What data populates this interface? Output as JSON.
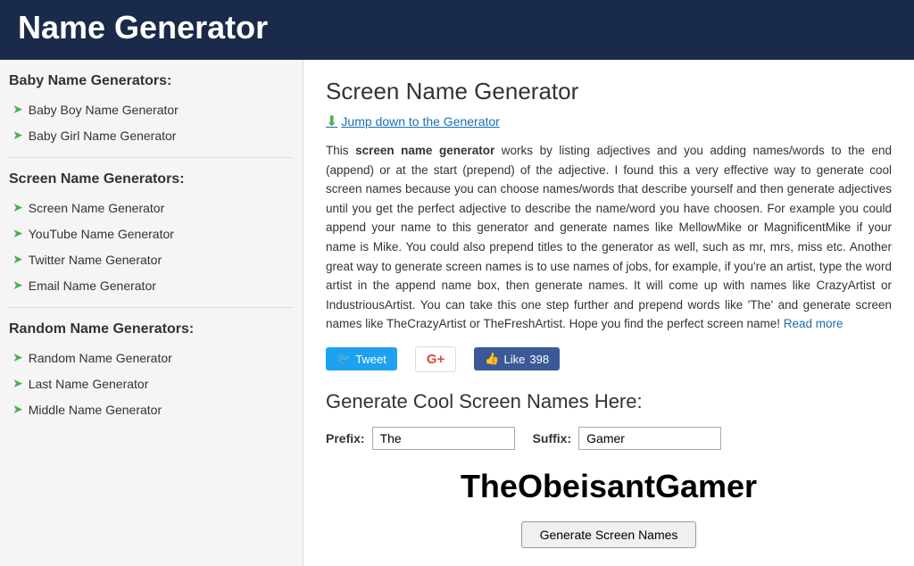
{
  "header": {
    "title": "Name Generator"
  },
  "sidebar": {
    "baby_section_title": "Baby Name Generators:",
    "baby_links": [
      {
        "label": "Baby Boy Name Generator",
        "id": "baby-boy"
      },
      {
        "label": "Baby Girl Name Generator",
        "id": "baby-girl"
      }
    ],
    "screen_section_title": "Screen Name Generators:",
    "screen_links": [
      {
        "label": "Screen Name Generator",
        "id": "screen-name"
      },
      {
        "label": "YouTube Name Generator",
        "id": "youtube-name"
      },
      {
        "label": "Twitter Name Generator",
        "id": "twitter-name"
      },
      {
        "label": "Email Name Generator",
        "id": "email-name"
      }
    ],
    "random_section_title": "Random Name Generators:",
    "random_links": [
      {
        "label": "Random Name Generator",
        "id": "random-name"
      },
      {
        "label": "Last Name Generator",
        "id": "last-name"
      },
      {
        "label": "Middle Name Generator",
        "id": "middle-name"
      }
    ]
  },
  "content": {
    "title": "Screen Name Generator",
    "jump_link_text": "Jump down to the Generator",
    "description_intro": "This ",
    "description_bold": "screen name generator",
    "description_rest": " works by listing adjectives and you adding names/words to the end (append) or at the start (prepend) of the adjective. I found this a very effective way to generate cool screen names because you can choose names/words that describe yourself and then generate adjectives until you get the perfect adjective to describe the name/word you have choosen. For example you could append your name to this generator and generate names like MellowMike or MagnificentMike if your name is Mike. You could also prepend titles to the generator as well, such as mr, mrs, miss etc. Another great way to generate screen names is to use names of jobs, for example, if you're an artist, type the word artist in the append name box, then generate names. It will come up with names like CrazyArtist or IndustriousArtist. You can take this one step further and prepend words like 'The' and generate screen names like TheCrazyArtist or TheFreshArtist. Hope you find the perfect screen name!",
    "read_more_text": "Read more",
    "tweet_label": "Tweet",
    "gplus_label": "G+",
    "like_label": "Like",
    "like_count": "398",
    "generate_section_title": "Generate Cool Screen Names Here:",
    "prefix_label": "Prefix:",
    "prefix_value": "The",
    "suffix_label": "Suffix:",
    "suffix_value": "Gamer",
    "generated_name": "TheObeisantGamer",
    "generate_btn_label": "Generate Screen Names"
  },
  "icons": {
    "arrow_right": "➨",
    "down_arrow": "⬇",
    "tweet_bird": "🐦"
  }
}
